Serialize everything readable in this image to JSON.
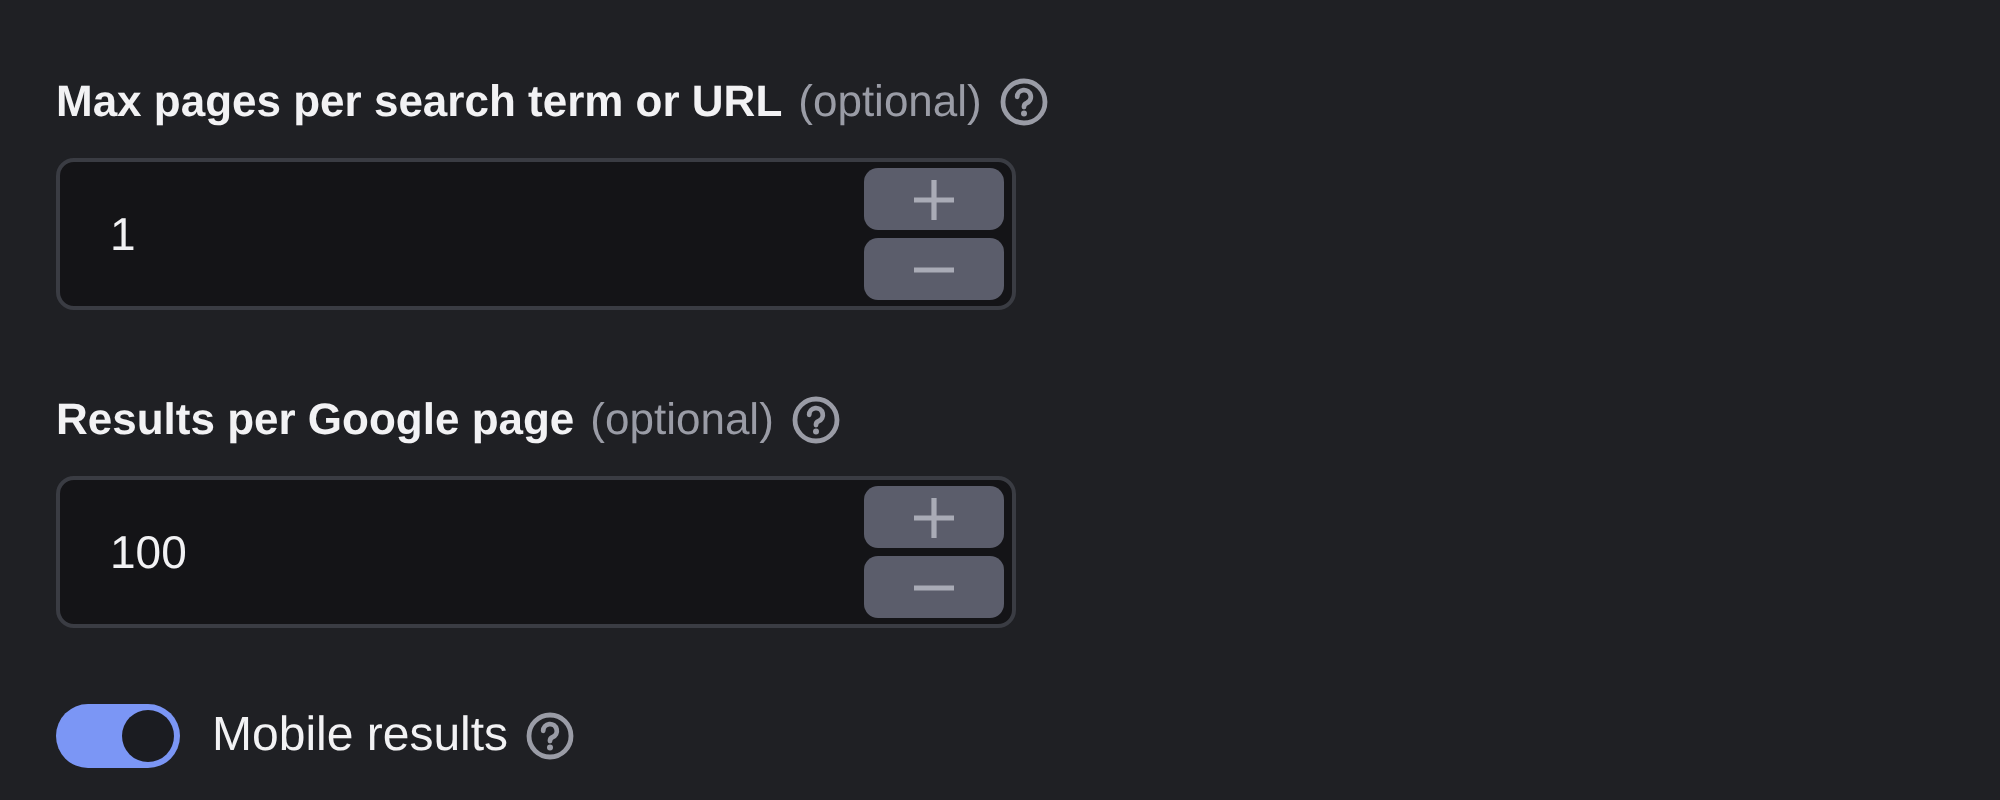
{
  "fields": [
    {
      "label": "Max pages per search term or URL",
      "hint": "(optional)",
      "value": "1"
    },
    {
      "label": "Results per Google page",
      "hint": "(optional)",
      "value": "100"
    }
  ],
  "toggle": {
    "label": "Mobile results",
    "on": true
  }
}
